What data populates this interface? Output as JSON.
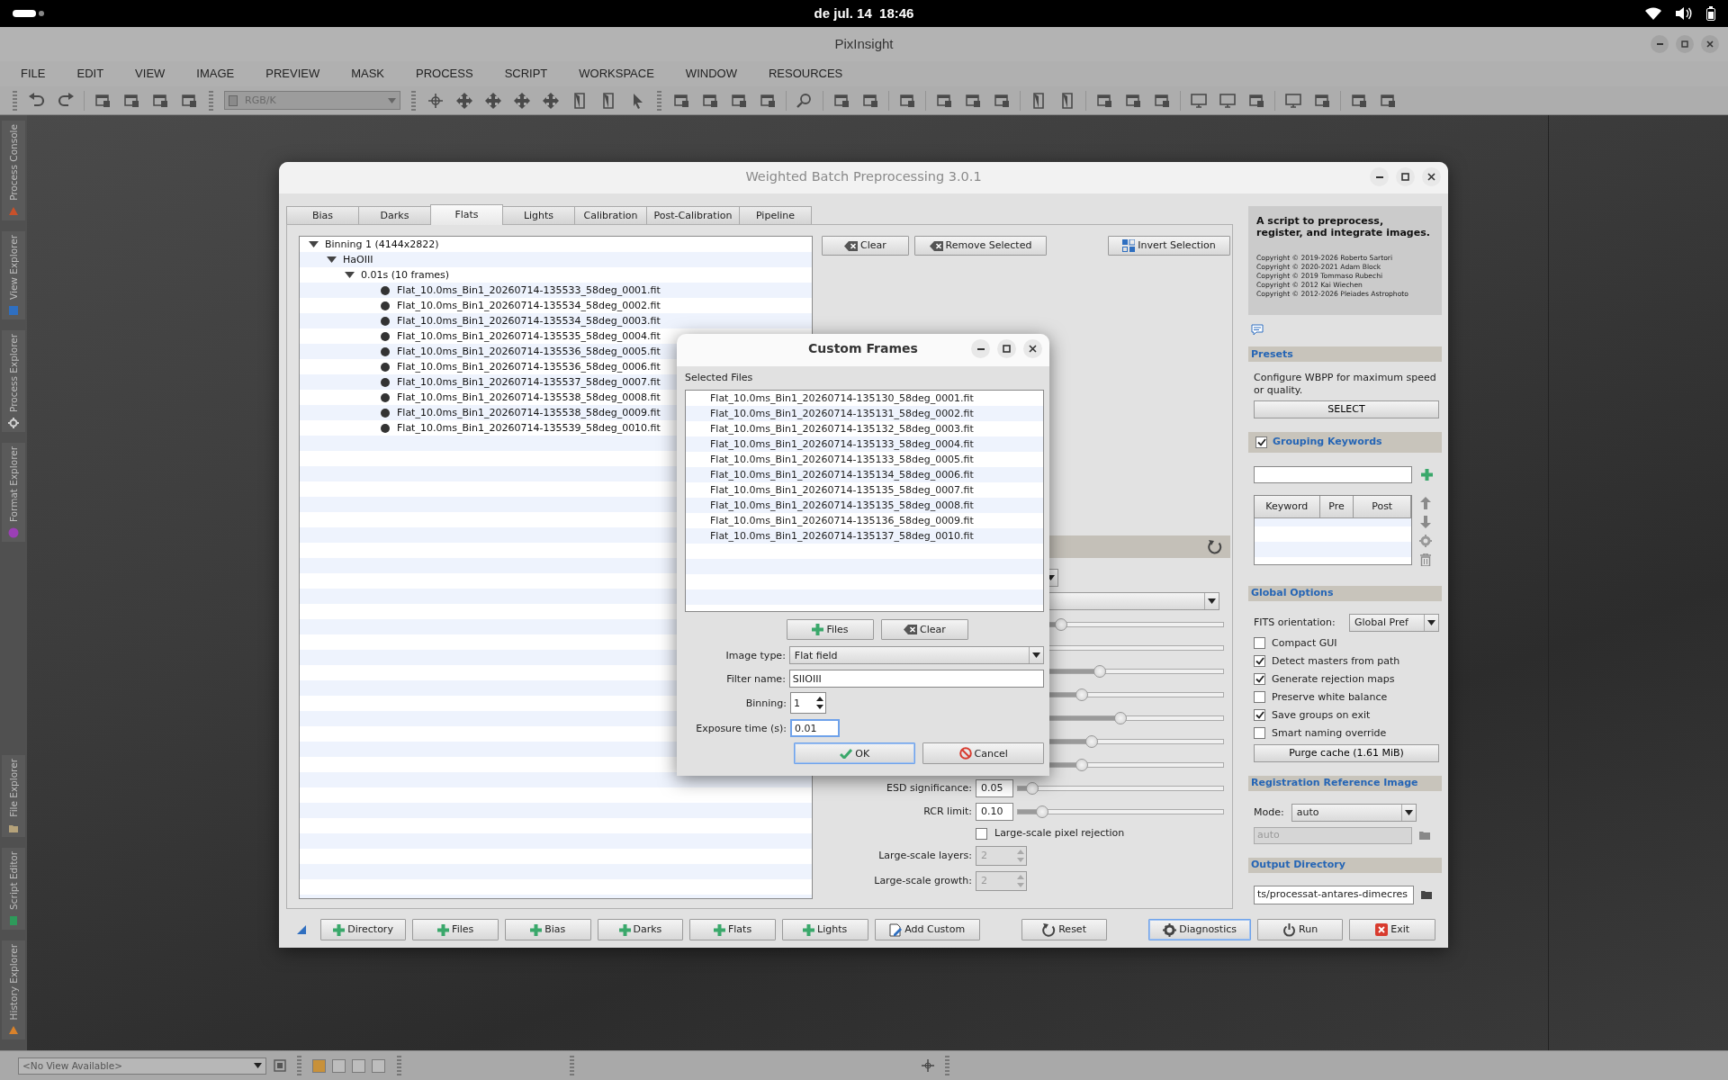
{
  "system_bar": {
    "clock": "de jul. 14  18:46"
  },
  "app": {
    "title": "PixInsight",
    "menu": [
      "FILE",
      "EDIT",
      "VIEW",
      "IMAGE",
      "PREVIEW",
      "MASK",
      "PROCESS",
      "SCRIPT",
      "WORKSPACE",
      "WINDOW",
      "RESOURCES"
    ],
    "toolbar_combo": "RGB/K"
  },
  "dock_tabs": [
    {
      "label": "Process Console",
      "color": "#c8512b"
    },
    {
      "label": "View Explorer",
      "color": "#2f6fc0"
    },
    {
      "label": "Process Explorer",
      "color": "#d0d0d0"
    },
    {
      "label": "Format Explorer",
      "color": "#9b3fb5"
    },
    {
      "label": "File Explorer",
      "color": "#b5a27a"
    },
    {
      "label": "Script Editor",
      "color": "#2e9a5a"
    },
    {
      "label": "History Explorer",
      "color": "#d9822b"
    }
  ],
  "wbpp": {
    "title": "Weighted Batch Preprocessing 3.0.1",
    "tabs": [
      {
        "label": "Bias",
        "selected": false
      },
      {
        "label": "Darks",
        "selected": false
      },
      {
        "label": "Flats",
        "selected": true
      },
      {
        "label": "Lights",
        "selected": false
      },
      {
        "label": "Calibration",
        "selected": false
      },
      {
        "label": "Post-Calibration",
        "selected": false
      },
      {
        "label": "Pipeline",
        "selected": false
      }
    ],
    "tree": [
      {
        "label": "Binning 1 (4144x2822)",
        "expanded": true,
        "children": [
          {
            "label": "HaOIII",
            "expanded": true,
            "children": [
              {
                "label": "0.01s (10 frames)",
                "expanded": true,
                "children": [
                  {
                    "label": "Flat_10.0ms_Bin1_20260714-135533_58deg_0001.fit"
                  },
                  {
                    "label": "Flat_10.0ms_Bin1_20260714-135534_58deg_0002.fit"
                  },
                  {
                    "label": "Flat_10.0ms_Bin1_20260714-135534_58deg_0003.fit"
                  },
                  {
                    "label": "Flat_10.0ms_Bin1_20260714-135535_58deg_0004.fit"
                  },
                  {
                    "label": "Flat_10.0ms_Bin1_20260714-135536_58deg_0005.fit"
                  },
                  {
                    "label": "Flat_10.0ms_Bin1_20260714-135536_58deg_0006.fit"
                  },
                  {
                    "label": "Flat_10.0ms_Bin1_20260714-135537_58deg_0007.fit"
                  },
                  {
                    "label": "Flat_10.0ms_Bin1_20260714-135538_58deg_0008.fit"
                  },
                  {
                    "label": "Flat_10.0ms_Bin1_20260714-135538_58deg_0009.fit"
                  },
                  {
                    "label": "Flat_10.0ms_Bin1_20260714-135539_58deg_0010.fit"
                  }
                ]
              }
            ]
          }
        ]
      }
    ],
    "list_buttons": [
      {
        "label": "Clear",
        "kind": "clear"
      },
      {
        "label": "Remove Selected",
        "kind": "clear"
      },
      {
        "label": "Invert Selection",
        "kind": "invert"
      }
    ],
    "settings_rows": [
      {
        "kind": "combo"
      },
      {
        "kind": "combo"
      },
      {
        "kind": "slider",
        "level": 0.21
      },
      {
        "kind": "slider"
      },
      {
        "kind": "slider",
        "level": 0.4
      },
      {
        "kind": "slider",
        "level": 0.31
      },
      {
        "kind": "slider",
        "level": 0.5
      },
      {
        "kind": "slider",
        "level": 0.36
      },
      {
        "kind": "slider",
        "level": 0.31
      },
      {
        "kind": "field_slider",
        "label": "ESD significance:",
        "value": "0.05",
        "level": 0.07
      },
      {
        "kind": "field_slider",
        "label": "RCR limit:",
        "value": "0.10",
        "level": 0.12
      },
      {
        "kind": "checkbox",
        "label": "Large-scale pixel rejection",
        "checked": false
      },
      {
        "kind": "spin",
        "label": "Large-scale layers:",
        "value": "2",
        "disabled": true
      },
      {
        "kind": "spin",
        "label": "Large-scale growth:",
        "value": "2",
        "disabled": true
      }
    ],
    "about": {
      "heading": "A script to preprocess, register, and integrate images.",
      "copyright": [
        "Copyright © 2019-2026 Roberto Sartori",
        "Copyright © 2020-2021 Adam Block",
        "Copyright © 2019 Tommaso Rubechi",
        "Copyright © 2012 Kai Wiechen",
        "Copyright © 2012-2026 Pleiades Astrophoto"
      ]
    },
    "presets": {
      "title": "Presets",
      "text": "Configure WBPP for maximum speed or quality.",
      "button": "SELECT"
    },
    "grouping": {
      "title": "Grouping Keywords",
      "checked": true,
      "columns": [
        "Keyword",
        "Pre",
        "Post"
      ]
    },
    "global_options": {
      "title": "Global Options",
      "fits_label": "FITS orientation:",
      "fits_value": "Global Pref",
      "options": [
        {
          "label": "Compact GUI",
          "checked": false
        },
        {
          "label": "Detect masters from path",
          "checked": true
        },
        {
          "label": "Generate rejection maps",
          "checked": true
        },
        {
          "label": "Preserve white balance",
          "checked": false
        },
        {
          "label": "Save groups on exit",
          "checked": true
        },
        {
          "label": "Smart naming override",
          "checked": false
        }
      ],
      "purge": "Purge cache (1.61 MiB)"
    },
    "registration": {
      "title": "Registration Reference Image",
      "mode_label": "Mode:",
      "mode_value": "auto",
      "path_value": "auto",
      "path_disabled": true
    },
    "output": {
      "title": "Output Directory",
      "value": "ts/processat-antares-dimecres"
    },
    "bottom_buttons": [
      {
        "label": "Directory",
        "kind": "add",
        "focused": false
      },
      {
        "label": "Files",
        "kind": "add",
        "focused": false
      },
      {
        "label": "Bias",
        "kind": "add",
        "focused": false
      },
      {
        "label": "Darks",
        "kind": "add",
        "focused": false
      },
      {
        "label": "Flats",
        "kind": "add",
        "focused": false
      },
      {
        "label": "Lights",
        "kind": "add",
        "focused": false
      },
      {
        "label": "Add Custom",
        "kind": "custom",
        "focused": false
      },
      {
        "label": "Reset",
        "kind": "reset",
        "focused": false
      },
      {
        "label": "Diagnostics",
        "kind": "gear",
        "focused": true
      },
      {
        "label": "Run",
        "kind": "power",
        "focused": false
      },
      {
        "label": "Exit",
        "kind": "exit",
        "focused": false
      }
    ]
  },
  "custom_frames": {
    "title": "Custom Frames",
    "section": "Selected Files",
    "files": [
      "Flat_10.0ms_Bin1_20260714-135130_58deg_0001.fit",
      "Flat_10.0ms_Bin1_20260714-135131_58deg_0002.fit",
      "Flat_10.0ms_Bin1_20260714-135132_58deg_0003.fit",
      "Flat_10.0ms_Bin1_20260714-135133_58deg_0004.fit",
      "Flat_10.0ms_Bin1_20260714-135133_58deg_0005.fit",
      "Flat_10.0ms_Bin1_20260714-135134_58deg_0006.fit",
      "Flat_10.0ms_Bin1_20260714-135135_58deg_0007.fit",
      "Flat_10.0ms_Bin1_20260714-135135_58deg_0008.fit",
      "Flat_10.0ms_Bin1_20260714-135136_58deg_0009.fit",
      "Flat_10.0ms_Bin1_20260714-135137_58deg_0010.fit"
    ],
    "files_button": "Files",
    "clear_button": "Clear",
    "image_type": {
      "label": "Image type:",
      "value": "Flat field"
    },
    "filter_name": {
      "label": "Filter name:",
      "value": "SIIOIII"
    },
    "binning": {
      "label": "Binning:",
      "value": "1"
    },
    "exposure": {
      "label": "Exposure time (s):",
      "value": "0.01",
      "focused": true
    },
    "ok": "OK",
    "cancel": "Cancel"
  },
  "status_bar": {
    "view_combo": "<No View Available>"
  }
}
